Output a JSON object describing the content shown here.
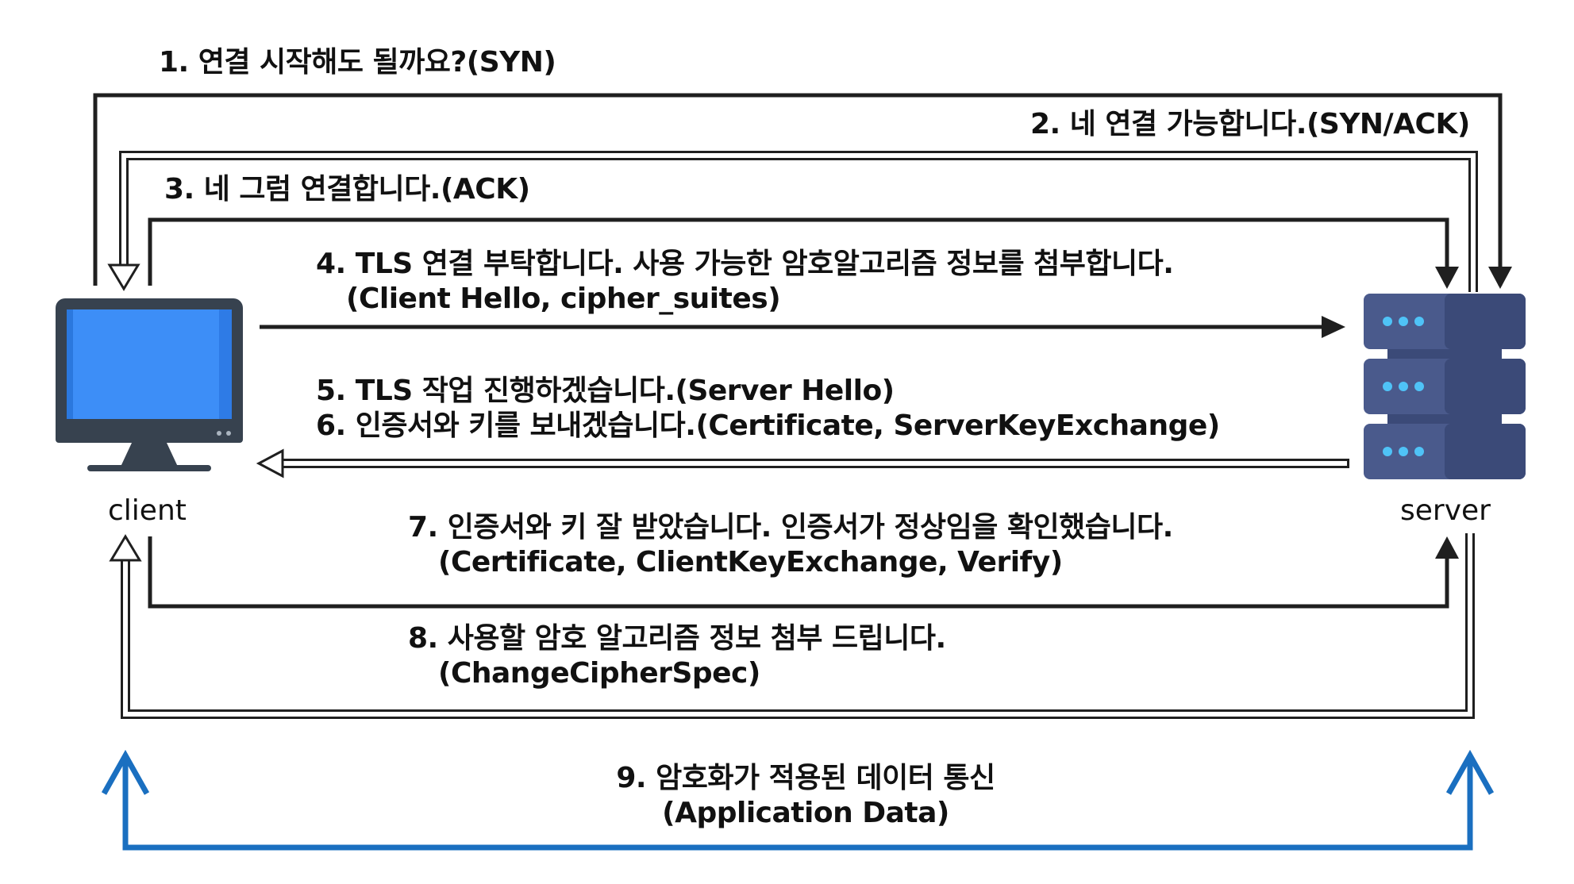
{
  "nodes": {
    "client": {
      "label": "client"
    },
    "server": {
      "label": "server"
    }
  },
  "steps": [
    {
      "id": 1,
      "lines": [
        "1. 연결 시작해도 될까요?(SYN)"
      ]
    },
    {
      "id": 2,
      "lines": [
        "2. 네 연결 가능합니다.(SYN/ACK)"
      ]
    },
    {
      "id": 3,
      "lines": [
        "3. 네 그럼 연결합니다.(ACK)"
      ]
    },
    {
      "id": 4,
      "lines": [
        "4. TLS 연결 부탁합니다. 사용 가능한 암호알고리즘 정보를 첨부합니다.",
        "(Client Hello, cipher_suites)"
      ]
    },
    {
      "id": 5,
      "lines": [
        "5. TLS 작업 진행하겠습니다.(Server Hello)"
      ]
    },
    {
      "id": 6,
      "lines": [
        "6. 인증서와 키를 보내겠습니다.(Certificate, ServerKeyExchange)"
      ]
    },
    {
      "id": 7,
      "lines": [
        "7. 인증서와 키 잘 받았습니다. 인증서가 정상임을 확인했습니다.",
        "(Certificate, ClientKeyExchange, Verify)"
      ]
    },
    {
      "id": 8,
      "lines": [
        "8. 사용할 암호 알고리즘 정보 첨부 드립니다.",
        "(ChangeCipherSpec)"
      ]
    },
    {
      "id": 9,
      "lines": [
        "9. 암호화가 적용된 데이터 통신",
        "(Application Data)"
      ]
    }
  ],
  "colors": {
    "line": "#1f1f1f",
    "data_arrow": "#1a6fc0",
    "monitor_screen": "#3d8ef7",
    "monitor_frame": "#37424f",
    "server_body": "#4a5a8c",
    "server_dark": "#3b4a78",
    "server_lights": "#4fc3f7"
  }
}
